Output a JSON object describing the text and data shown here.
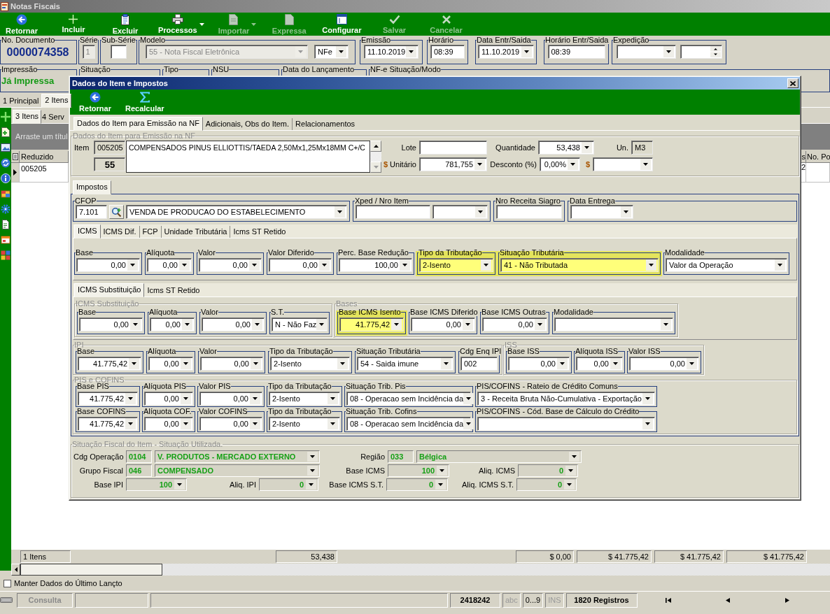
{
  "window": {
    "title": "Notas Fiscais"
  },
  "toolbar": [
    {
      "label": "Retornar",
      "disabled": false,
      "menu": false
    },
    {
      "label": "Incluir",
      "disabled": false,
      "menu": false
    },
    {
      "label": "Excluir",
      "disabled": false,
      "menu": false
    },
    {
      "label": "Processos",
      "disabled": false,
      "menu": true
    },
    {
      "label": "Importar",
      "disabled": true,
      "menu": true
    },
    {
      "label": "Expressa",
      "disabled": true,
      "menu": false
    },
    {
      "label": "Configurar",
      "disabled": false,
      "menu": false
    },
    {
      "label": "Salvar",
      "disabled": true,
      "menu": false
    },
    {
      "label": "Cancelar",
      "disabled": true,
      "menu": false
    }
  ],
  "header": [
    {
      "label": "No. Documento",
      "controls": [
        {
          "kind": "docnum",
          "value": "0000074358"
        }
      ]
    },
    {
      "label": "Série",
      "controls": [
        {
          "kind": "text",
          "value": "1",
          "disabled": true
        }
      ]
    },
    {
      "label": "Sub-Série",
      "controls": [
        {
          "kind": "text",
          "disabled": false
        }
      ]
    },
    {
      "label": "Modelo",
      "controls": [
        {
          "kind": "combo",
          "value": "55 - Nota Fiscal Eletrônica",
          "disabled": true
        },
        {
          "kind": "combo",
          "value": "NFe",
          "disabled": false
        }
      ]
    },
    {
      "label": "Emissão",
      "controls": [
        {
          "kind": "combo",
          "value": "11.10.2019",
          "disabled": false
        }
      ]
    },
    {
      "label": "Horário",
      "controls": [
        {
          "kind": "text",
          "value": "08:39",
          "disabled": false
        }
      ]
    },
    {
      "label": "Data Entr/Saida",
      "controls": [
        {
          "kind": "combo",
          "value": "11.10.2019",
          "disabled": false
        }
      ]
    },
    {
      "label": "Horário Entr/Saida",
      "controls": [
        {
          "kind": "text",
          "value": "08:39",
          "disabled": false
        }
      ]
    },
    {
      "label": "Expedição",
      "controls": [
        {
          "kind": "combo",
          "disabled": false
        },
        {
          "kind": "spin",
          "disabled": false
        }
      ]
    }
  ],
  "info": [
    {
      "label": "Impressão",
      "value": "Já Impressa"
    },
    {
      "label": "Situação"
    },
    {
      "label": "Tipo"
    },
    {
      "label": "NSU"
    },
    {
      "label": "Data do Lançamento"
    },
    {
      "label": "NF-e Situação/Modo"
    }
  ],
  "main_tabs": [
    {
      "label": "1 Principal",
      "selected": false
    },
    {
      "label": "2 Itens",
      "selected": true
    }
  ],
  "item_tabs": [
    {
      "label": "3 Itens",
      "selected": true
    },
    {
      "label": "4 Serv",
      "selected": false
    }
  ],
  "group_panel": {
    "hint": "Arraste um títul"
  },
  "table": {
    "columns": [
      "Reduzido",
      "s",
      "No. Po"
    ],
    "rows": [
      {
        "cells": [
          "005205",
          "2"
        ],
        "selected": true
      }
    ]
  },
  "totals": [
    "1 Itens",
    "53,438",
    "$ 0,00",
    "$ 41.775,42",
    "$ 41.775,42",
    "$ 41.775,42"
  ],
  "keep_data": {
    "label": "Manter Dados do Último Lançto",
    "checked": false
  },
  "status_bar": {
    "mode": "Consulta",
    "record": "2418242",
    "indicators": [
      {
        "text": "abc",
        "on": false
      },
      {
        "text": "0...9",
        "on": true
      },
      {
        "text": "INS",
        "on": false
      }
    ],
    "count": "1820 Registros"
  },
  "dialog": {
    "title": "Dados do Item e Impostos",
    "toolbar": [
      {
        "label": "Retornar"
      },
      {
        "label": "Recalcular"
      }
    ],
    "tabs": [
      {
        "label": "Dados do Item para Emissão na NF",
        "selected": true
      },
      {
        "label": "Adicionais, Obs do Item.",
        "selected": false
      },
      {
        "label": "Relacionamentos",
        "selected": false
      }
    ],
    "item": {
      "title": "Dados do Item para Emissão na NF",
      "item_label": "Item",
      "code": "005205",
      "model": "55",
      "description": "COMPENSADOS PINUS ELLIOTTIS/TAEDA 2,50Mx1,25Mx18MM C+/C",
      "fields": [
        {
          "label": "Lote",
          "kind": "text"
        },
        {
          "label": "Quantidade",
          "kind": "numcombo",
          "value": "53,438"
        },
        {
          "label": "Un.",
          "kind": "readonly",
          "value": "M3"
        },
        {
          "label": "**$** Unitário",
          "kind": "numcombo",
          "value": "781,755"
        },
        {
          "label": "Desconto (%)",
          "kind": "numcombo",
          "value": "0,00%"
        },
        {
          "label": "$",
          "kind": "combo"
        }
      ]
    },
    "tax_tabs": [
      {
        "label": "Impostos",
        "selected": true
      }
    ],
    "cfop": [
      {
        "label": "CFOP",
        "controls": [
          {
            "kind": "text",
            "value": "7.101"
          },
          {
            "kind": "search"
          },
          {
            "kind": "combo",
            "value": "VENDA DE PRODUCAO DO ESTABELECIMENTO"
          }
        ]
      },
      {
        "label": "Xped / Nro Item",
        "controls": [
          {
            "kind": "text"
          },
          {
            "kind": "combo"
          }
        ]
      },
      {
        "label": "Nro Receita Siagro",
        "controls": [
          {
            "kind": "text"
          }
        ]
      },
      {
        "label": "Data Entrega",
        "controls": [
          {
            "kind": "combo"
          }
        ]
      }
    ],
    "icms_tabs": [
      {
        "label": "ICMS",
        "selected": true
      },
      {
        "label": "ICMS Dif.",
        "selected": false
      },
      {
        "label": "FCP",
        "selected": false
      },
      {
        "label": "Unidade Tributária",
        "selected": false
      },
      {
        "label": "Icms ST Retido",
        "selected": false
      }
    ],
    "icms": [
      {
        "label": "Base",
        "kind": "numcombo",
        "value": "0,00",
        "highlighted": false
      },
      {
        "label": "Alíquota",
        "kind": "numcombo",
        "value": "0,00",
        "highlighted": false
      },
      {
        "label": "Valor",
        "kind": "numcombo",
        "value": "0,00",
        "highlighted": false
      },
      {
        "label": "Valor Diferido",
        "kind": "numcombo",
        "value": "0,00",
        "highlighted": false
      },
      {
        "label": "Perc. Base Redução",
        "kind": "numcombo",
        "value": "100,00",
        "highlighted": false
      },
      {
        "label": "Tipo da Tributação",
        "kind": "combo",
        "value": "2-Isento",
        "highlighted": true
      },
      {
        "label": "Situação Tributária",
        "kind": "combo",
        "value": "41 - Não Tributada",
        "highlighted": true
      },
      {
        "label": "Modalidade",
        "kind": "combo",
        "value": "Valor da Operação",
        "highlighted": false
      }
    ],
    "st_tabs": [
      {
        "label": "ICMS Substituição",
        "selected": true
      },
      {
        "label": "Icms ST Retido",
        "selected": false
      }
    ],
    "st": {
      "title": "ICMS Substituição",
      "fields": [
        {
          "label": "Base",
          "kind": "numcombo",
          "value": "0,00",
          "highlighted": false
        },
        {
          "label": "Alíquota",
          "kind": "numcombo",
          "value": "0,00",
          "highlighted": false
        },
        {
          "label": "Valor",
          "kind": "numcombo",
          "value": "0,00",
          "highlighted": false
        },
        {
          "label": "S.T.",
          "kind": "combo",
          "value": "N - Não Faz",
          "highlighted": false
        }
      ]
    },
    "bases": {
      "title": "Bases",
      "fields": [
        {
          "label": "Base ICMS Isento",
          "kind": "numcombo",
          "value": "41.775,42",
          "highlighted": true
        },
        {
          "label": "Base ICMS Diferido",
          "kind": "numcombo",
          "value": "0,00",
          "highlighted": false
        },
        {
          "label": "Base ICMS Outras",
          "kind": "numcombo",
          "value": "0,00",
          "highlighted": false
        },
        {
          "label": "Modalidade",
          "kind": "combo",
          "highlighted": false
        }
      ]
    },
    "ipi": {
      "title": "IPI",
      "fields": [
        {
          "label": "Base",
          "kind": "numcombo",
          "value": "41.775,42"
        },
        {
          "label": "Alíquota",
          "kind": "numcombo",
          "value": "0,00"
        },
        {
          "label": "Valor",
          "kind": "numcombo",
          "value": "0,00"
        },
        {
          "label": "Tipo da Tributação",
          "kind": "combo",
          "value": "2-Isento"
        },
        {
          "label": "Situação Tributária",
          "kind": "combo",
          "value": "54 - Saida imune"
        },
        {
          "label": "Cdg Enq IPI",
          "kind": "text",
          "value": "002"
        }
      ]
    },
    "iss": {
      "title": "ISS",
      "fields": [
        {
          "label": "Base ISS",
          "kind": "numcombo",
          "value": "0,00"
        },
        {
          "label": "Alíquota ISS",
          "kind": "numcombo",
          "value": "0,00"
        },
        {
          "label": "Valor ISS",
          "kind": "numcombo",
          "value": "0,00"
        }
      ]
    },
    "pis_cofins": {
      "title": "PIS e COFINS",
      "rows": [
        {
          "fields": [
            {
              "label": "Base PIS",
              "kind": "numcombo",
              "value": "41.775,42"
            },
            {
              "label": "Alíquota PIS",
              "kind": "numcombo",
              "value": "0,00"
            },
            {
              "label": "Valor PIS",
              "kind": "numcombo",
              "value": "0,00"
            },
            {
              "label": "Tipo da Tributação",
              "kind": "combo",
              "value": "2-Isento"
            },
            {
              "label": "Situação Trib. Pis",
              "kind": "combo",
              "value": "08 - Operacao sem Incidência da"
            },
            {
              "label": "PIS/COFINS - Rateio de Crédito Comuns",
              "kind": "combo",
              "value": "3 - Receita Bruta Não-Cumulativa - Exportação"
            }
          ]
        },
        {
          "fields": [
            {
              "label": "Base COFINS",
              "kind": "numcombo",
              "value": "41.775,42"
            },
            {
              "label": "Alíquota COF.",
              "kind": "numcombo",
              "value": "0,00"
            },
            {
              "label": "Valor COFINS",
              "kind": "numcombo",
              "value": "0,00"
            },
            {
              "label": "Tipo da Tributação",
              "kind": "combo",
              "value": "2-Isento"
            },
            {
              "label": "Situação Trib. Cofins",
              "kind": "combo",
              "value": "08 - Operacao sem Incidência da"
            },
            {
              "label": "PIS/COFINS - Cód. Base de Cálculo do Crédito",
              "kind": "combo"
            }
          ]
        }
      ]
    },
    "fiscal": {
      "title": "Situação Fiscal do Item - Situação Utilizada.",
      "rows": [
        {
          "fields": [
            {
              "label": "Cdg Operação",
              "code": "0104",
              "kind": "combo",
              "value": "V. PRODUTOS - MERCADO EXTERNO"
            },
            {
              "label": "Região",
              "code": "033",
              "kind": "combo",
              "value": "Bélgica"
            }
          ]
        },
        {
          "fields": [
            {
              "label": "Grupo Fiscal",
              "code": "046",
              "kind": "combo",
              "value": "COMPENSADO"
            },
            {
              "label": "Base ICMS",
              "kind": "numcombo",
              "value": "100"
            },
            {
              "label": "Aliq. ICMS",
              "kind": "numcombo",
              "value": "0"
            }
          ]
        },
        {
          "fields": [
            {
              "label": "Base IPI",
              "kind": "numcombo",
              "value": "100"
            },
            {
              "label": "Aliq. IPI",
              "kind": "numcombo",
              "value": "0"
            },
            {
              "label": "Base ICMS S.T.",
              "kind": "numcombo",
              "value": "0"
            },
            {
              "label": "Aliq. ICMS S.T.",
              "kind": "numcombo",
              "value": "0"
            }
          ]
        }
      ]
    }
  }
}
